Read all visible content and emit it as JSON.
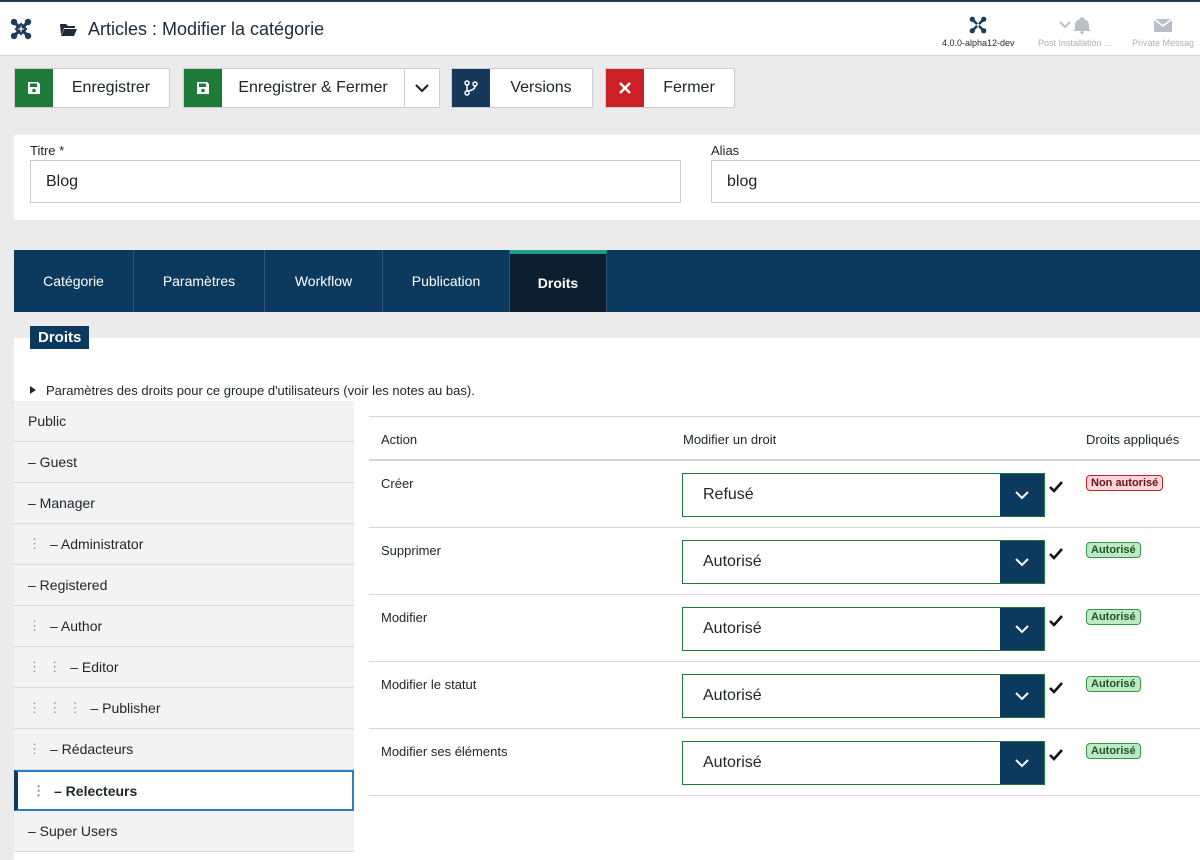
{
  "header": {
    "title": "Articles : Modifier la catégorie",
    "version": "4.0.0-alpha12-dev",
    "post_installation": "Post Installation ...",
    "private_messages": "Private Messag"
  },
  "toolbar": {
    "save": "Enregistrer",
    "save_close": "Enregistrer & Fermer",
    "versions": "Versions",
    "close": "Fermer"
  },
  "form": {
    "title_label": "Titre *",
    "title_value": "Blog",
    "alias_label": "Alias",
    "alias_value": "blog"
  },
  "tabs": [
    {
      "label": "Catégorie"
    },
    {
      "label": "Paramètres"
    },
    {
      "label": "Workflow"
    },
    {
      "label": "Publication"
    },
    {
      "label": "Droits"
    }
  ],
  "rights": {
    "legend": "Droits",
    "summary": "Paramètres des droits pour ce groupe d'utilisateurs (voir les notes au bas).",
    "groups": [
      {
        "label": "Public",
        "depth": 0
      },
      {
        "label": "– Guest",
        "depth": 0
      },
      {
        "label": "– Manager",
        "depth": 0
      },
      {
        "label": "– Administrator",
        "depth": 1
      },
      {
        "label": "– Registered",
        "depth": 0
      },
      {
        "label": "– Author",
        "depth": 1
      },
      {
        "label": "– Editor",
        "depth": 2
      },
      {
        "label": "– Publisher",
        "depth": 3
      },
      {
        "label": "– Rédacteurs",
        "depth": 1
      },
      {
        "label": "– Relecteurs",
        "depth": 1
      },
      {
        "label": "– Super Users",
        "depth": 0
      }
    ],
    "active_group": "– Relecteurs",
    "columns": {
      "action": "Action",
      "modify": "Modifier un droit",
      "applied": "Droits appliqués"
    },
    "rows": [
      {
        "action": "Créer",
        "setting": "Refusé",
        "applied": "Non autorisé"
      },
      {
        "action": "Supprimer",
        "setting": "Autorisé",
        "applied": "Autorisé"
      },
      {
        "action": "Modifier",
        "setting": "Autorisé",
        "applied": "Autorisé"
      },
      {
        "action": "Modifier le statut",
        "setting": "Autorisé",
        "applied": "Autorisé"
      },
      {
        "action": "Modifier ses éléments",
        "setting": "Autorisé",
        "applied": "Autorisé"
      }
    ]
  },
  "colors": {
    "primary": "#0b3a5e",
    "success": "#1e7a38",
    "danger": "#cc2027",
    "tab_active_accent": "#1ba187"
  }
}
